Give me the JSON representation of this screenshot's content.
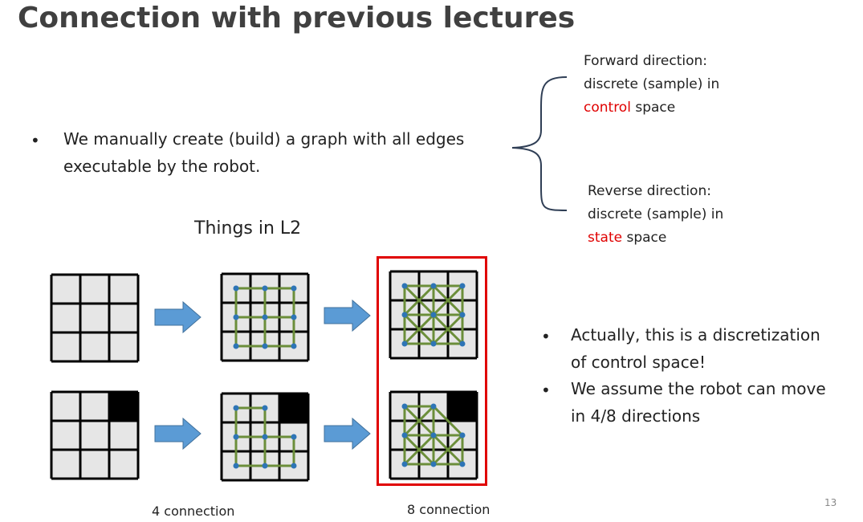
{
  "slide": {
    "title": "Connection with previous lectures",
    "page_number": "13"
  },
  "main_bullet": {
    "marker": "•",
    "lines": [
      "We manually create (build) a graph with all edges",
      "executable by the robot."
    ]
  },
  "forward": {
    "line1": "Forward direction:",
    "line2": "discrete (sample) in",
    "highlight": "control",
    "rest": " space"
  },
  "reverse": {
    "line1": "Reverse direction:",
    "line2": "discrete (sample) in",
    "highlight": "state",
    "rest": " space"
  },
  "subtitle": "Things in L2",
  "captions": {
    "four": "4 connection",
    "eight": "8 connection"
  },
  "right_bullets": [
    {
      "marker": "•",
      "lines": [
        "Actually, this is a discretization",
        "of control space!"
      ]
    },
    {
      "marker": "•",
      "lines": [
        "We assume the robot can move",
        "in 4/8 directions"
      ]
    }
  ],
  "colors": {
    "accent_red": "#e00000",
    "edge_green": "#6b8e3a",
    "node_blue": "#2e75b6",
    "arrow_blue": "#5b9bd5",
    "cell_gray": "#e6e6e6",
    "obstacle": "#000000"
  }
}
